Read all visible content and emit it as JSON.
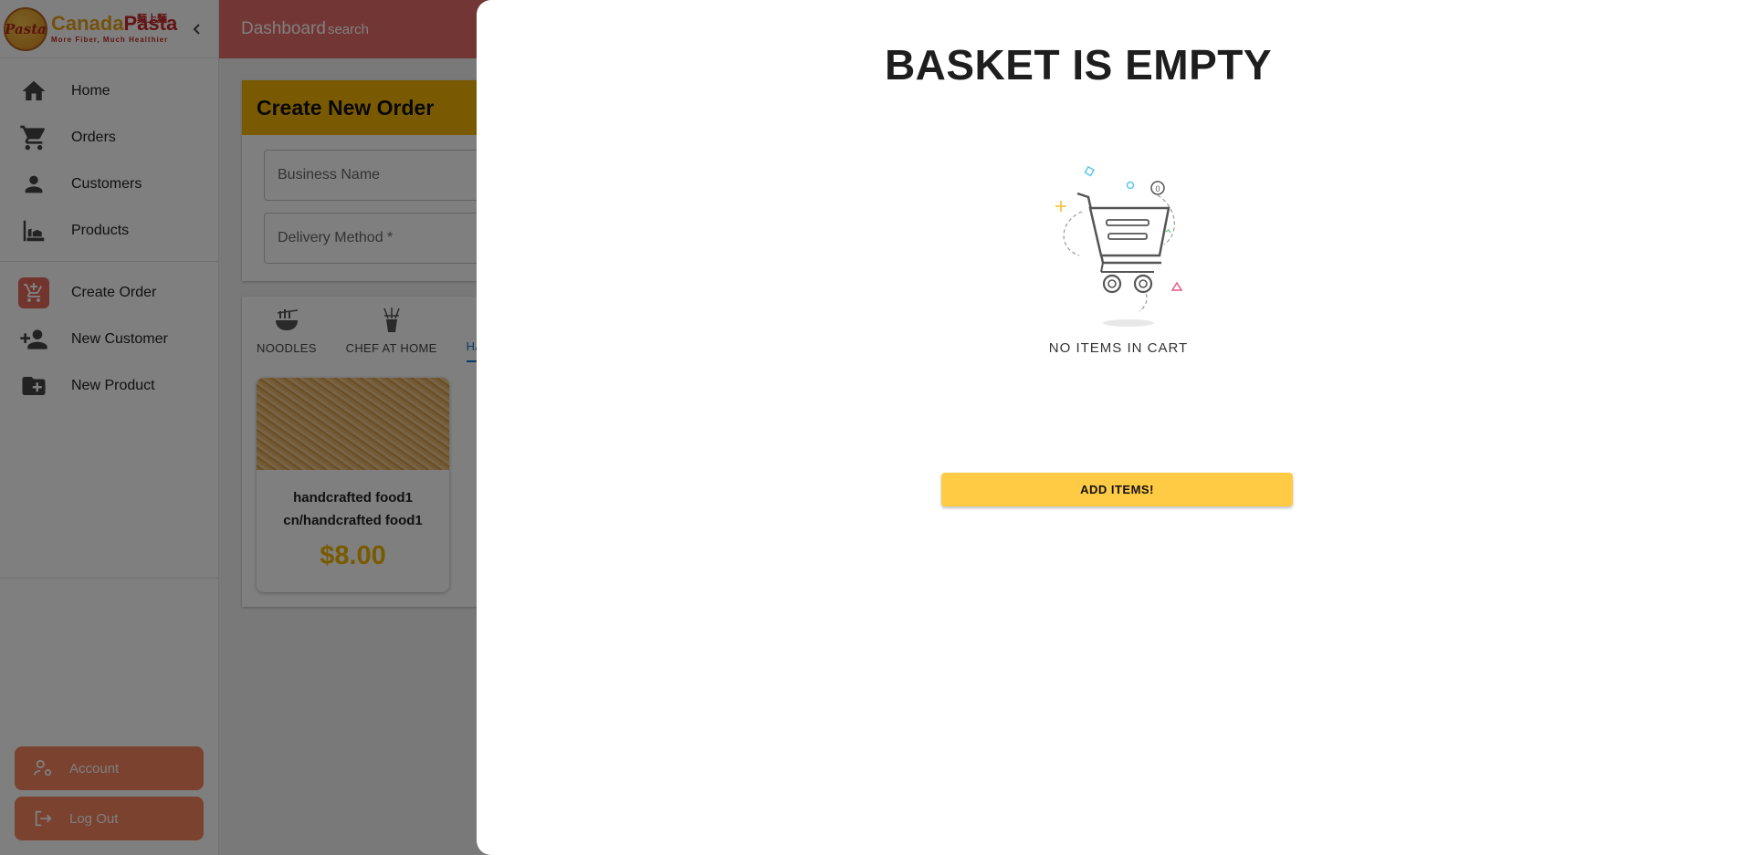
{
  "brand": {
    "logo_mark": "Pasta",
    "name_part1": "Canada",
    "name_part2": "Pasta",
    "name_cn": "麵上麵",
    "tagline": "More Fiber, Much Healthier"
  },
  "sidebar": {
    "items": [
      {
        "label": "Home",
        "icon": "home-icon"
      },
      {
        "label": "Orders",
        "icon": "cart-icon"
      },
      {
        "label": "Customers",
        "icon": "person-icon"
      },
      {
        "label": "Products",
        "icon": "products-icon"
      }
    ],
    "actions": [
      {
        "label": "Create Order",
        "icon": "add-cart-icon"
      },
      {
        "label": "New Customer",
        "icon": "person-add-icon"
      },
      {
        "label": "New Product",
        "icon": "folder-add-icon"
      }
    ],
    "account_label": "Account",
    "logout_label": "Log Out"
  },
  "header": {
    "title": "Dashboard",
    "search_label": "search"
  },
  "order_form": {
    "title": "Create New Order",
    "business_name_label": "Business Name",
    "delivery_method_label": "Delivery Method *"
  },
  "categories": {
    "tabs": [
      {
        "label": "NOODLES"
      },
      {
        "label": "CHEF AT HOME"
      },
      {
        "label": "HAN"
      }
    ]
  },
  "products": [
    {
      "name_line1": "handcrafted food1",
      "name_line2": "cn/handcrafted food1",
      "price": "$8.00"
    }
  ],
  "basket": {
    "title": "BASKET IS EMPTY",
    "empty_text": "NO ITEMS IN CART",
    "add_button_label": "ADD ITEMS!"
  },
  "colors": {
    "header": "#e56e68",
    "accent_yellow": "#f5b400",
    "button_yellow": "#ffca44",
    "side_button": "#f4845f",
    "tab_selected": "#1976d2"
  }
}
